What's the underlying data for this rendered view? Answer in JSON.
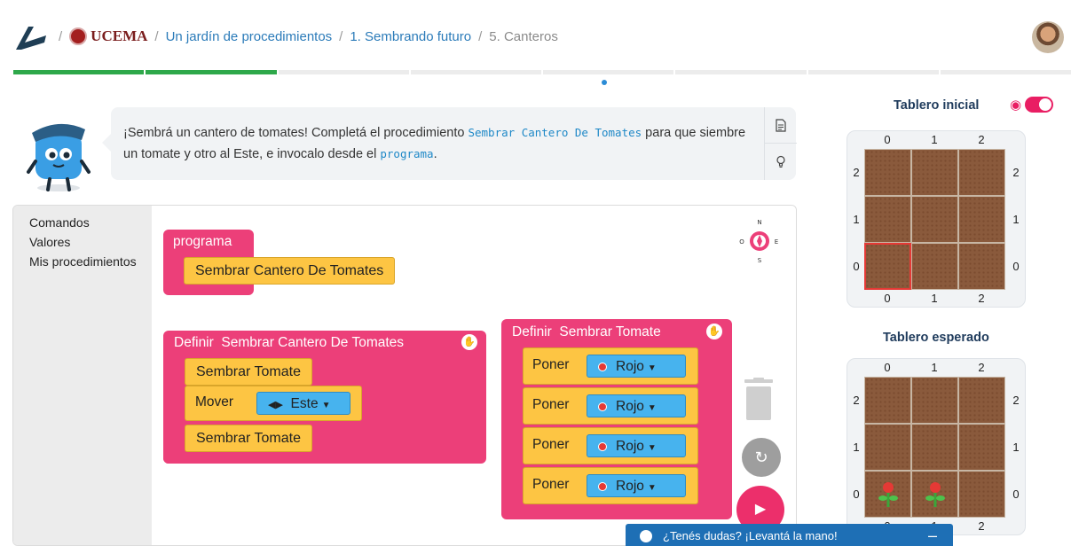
{
  "breadcrumb": {
    "institution": "UCEMA",
    "course": "Un jardín de procedimientos",
    "unit": "1. Sembrando futuro",
    "current": "5. Canteros"
  },
  "progress": {
    "done_segments": 2,
    "total_segments": 8
  },
  "instructions": {
    "text_1": "¡Sembrá un cantero de tomates! Completá el procedimiento ",
    "code_1": "Sembrar Cantero De Tomates",
    "text_2": " para que siembre un tomate y otro al Este, e invocalo desde el ",
    "code_2": "programa",
    "text_3": "."
  },
  "toolbox": [
    "Comandos",
    "Valores",
    "Mis procedimientos"
  ],
  "blocks": {
    "programa_label": "programa",
    "programa_call": "Sembrar Cantero De Tomates",
    "def1_keyword": "Definir",
    "def1_name": "Sembrar Cantero De Tomates",
    "def1_stmt1": "Sembrar Tomate",
    "def1_mover": "Mover",
    "def1_dir": "Este",
    "def1_stmt3": "Sembrar Tomate",
    "def2_keyword": "Definir",
    "def2_name": "Sembrar Tomate",
    "poner_label": "Poner",
    "color_value": "Rojo"
  },
  "compass": {
    "n": "N",
    "s": "S",
    "e": "E",
    "o": "O"
  },
  "boards": {
    "initial_title": "Tablero inicial",
    "expected_title": "Tablero esperado",
    "cols": [
      "0",
      "1",
      "2"
    ],
    "rows": [
      "2",
      "1",
      "0"
    ]
  },
  "help_bar": {
    "label": "¿Tenés dudas? ¡Levantá la mano!",
    "minus": "–"
  },
  "colors": {
    "accent_pink": "#ec3f79",
    "block_yellow": "#fdc543",
    "block_blue": "#47b3ee",
    "progress_green": "#2ea84a"
  }
}
